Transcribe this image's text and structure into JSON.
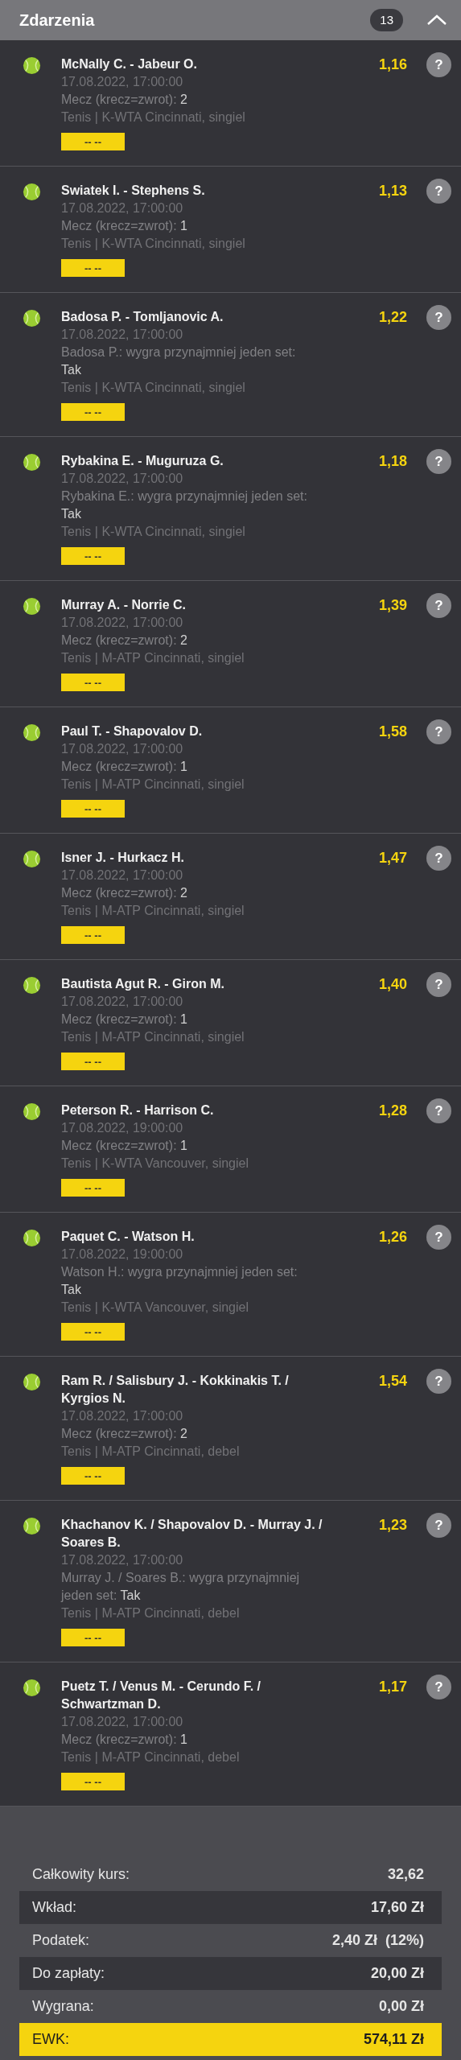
{
  "header": {
    "title": "Zdarzenia",
    "count": "13"
  },
  "events": [
    {
      "title": "McNally C. - Jabeur O.",
      "date": "17.08.2022, 17:00:00",
      "pick_label": "Mecz (krecz=zwrot):",
      "pick_value": "2",
      "league": "Tenis | K-WTA Cincinnati, singiel",
      "odds": "1,16",
      "result": "-- --",
      "help": "?"
    },
    {
      "title": "Swiatek I. - Stephens S.",
      "date": "17.08.2022, 17:00:00",
      "pick_label": "Mecz (krecz=zwrot):",
      "pick_value": "1",
      "league": "Tenis | K-WTA Cincinnati, singiel",
      "odds": "1,13",
      "result": "-- --",
      "help": "?"
    },
    {
      "title": "Badosa P. - Tomljanovic A.",
      "date": "17.08.2022, 17:00:00",
      "pick_label": "Badosa P.: wygra przynajmniej jeden set:",
      "pick_value": "Tak",
      "league": "Tenis | K-WTA Cincinnati, singiel",
      "odds": "1,22",
      "result": "-- --",
      "help": "?"
    },
    {
      "title": "Rybakina E. - Muguruza G.",
      "date": "17.08.2022, 17:00:00",
      "pick_label": "Rybakina E.: wygra przynajmniej jeden set:",
      "pick_value": "Tak",
      "league": "Tenis | K-WTA Cincinnati, singiel",
      "odds": "1,18",
      "result": "-- --",
      "help": "?"
    },
    {
      "title": "Murray A. - Norrie C.",
      "date": "17.08.2022, 17:00:00",
      "pick_label": "Mecz (krecz=zwrot):",
      "pick_value": "2",
      "league": "Tenis | M-ATP Cincinnati, singiel",
      "odds": "1,39",
      "result": "-- --",
      "help": "?"
    },
    {
      "title": "Paul T. - Shapovalov D.",
      "date": "17.08.2022, 17:00:00",
      "pick_label": "Mecz (krecz=zwrot):",
      "pick_value": "1",
      "league": "Tenis | M-ATP Cincinnati, singiel",
      "odds": "1,58",
      "result": "-- --",
      "help": "?"
    },
    {
      "title": "Isner J. - Hurkacz H.",
      "date": "17.08.2022, 17:00:00",
      "pick_label": "Mecz (krecz=zwrot):",
      "pick_value": "2",
      "league": "Tenis | M-ATP Cincinnati, singiel",
      "odds": "1,47",
      "result": "-- --",
      "help": "?"
    },
    {
      "title": "Bautista Agut R. - Giron M.",
      "date": "17.08.2022, 17:00:00",
      "pick_label": "Mecz (krecz=zwrot):",
      "pick_value": "1",
      "league": "Tenis | M-ATP Cincinnati, singiel",
      "odds": "1,40",
      "result": "-- --",
      "help": "?"
    },
    {
      "title": "Peterson R. - Harrison C.",
      "date": "17.08.2022, 19:00:00",
      "pick_label": "Mecz (krecz=zwrot):",
      "pick_value": "1",
      "league": "Tenis | K-WTA Vancouver, singiel",
      "odds": "1,28",
      "result": "-- --",
      "help": "?"
    },
    {
      "title": "Paquet C. - Watson H.",
      "date": "17.08.2022, 19:00:00",
      "pick_label": "Watson H.: wygra przynajmniej jeden set:",
      "pick_value": "Tak",
      "league": "Tenis | K-WTA Vancouver, singiel",
      "odds": "1,26",
      "result": "-- --",
      "help": "?"
    },
    {
      "title": "Ram R. / Salisbury J. - Kokkinakis T. / Kyrgios N.",
      "date": "17.08.2022, 17:00:00",
      "pick_label": "Mecz (krecz=zwrot):",
      "pick_value": "2",
      "league": "Tenis | M-ATP Cincinnati, debel",
      "odds": "1,54",
      "result": "-- --",
      "help": "?"
    },
    {
      "title": "Khachanov K. / Shapovalov D. - Murray J. / Soares B.",
      "date": "17.08.2022, 17:00:00",
      "pick_label": "Murray J. / Soares B.: wygra przynajmniej jeden set:",
      "pick_value": "Tak",
      "league": "Tenis | M-ATP Cincinnati, debel",
      "odds": "1,23",
      "result": "-- --",
      "help": "?"
    },
    {
      "title": "Puetz T. / Venus M. - Cerundo F. / Schwartzman D.",
      "date": "17.08.2022, 17:00:00",
      "pick_label": "Mecz (krecz=zwrot):",
      "pick_value": "1",
      "league": "Tenis | M-ATP Cincinnati, debel",
      "odds": "1,17",
      "result": "-- --",
      "help": "?"
    }
  ],
  "summary": [
    {
      "label": "Całkowity kurs:",
      "value": "32,62",
      "kind": "plain"
    },
    {
      "label": "Wkład:",
      "value": "17,60 Zł",
      "kind": "shaded"
    },
    {
      "label": "Podatek:",
      "value": "2,40 Zł  (12%)",
      "kind": "plain"
    },
    {
      "label": "Do zapłaty:",
      "value": "20,00 Zł",
      "kind": "shaded"
    },
    {
      "label": "Wygrana:",
      "value": "0,00 Zł",
      "kind": "plain"
    },
    {
      "label": "EWK:",
      "value": "574,11 Zł",
      "kind": "highlight"
    }
  ]
}
